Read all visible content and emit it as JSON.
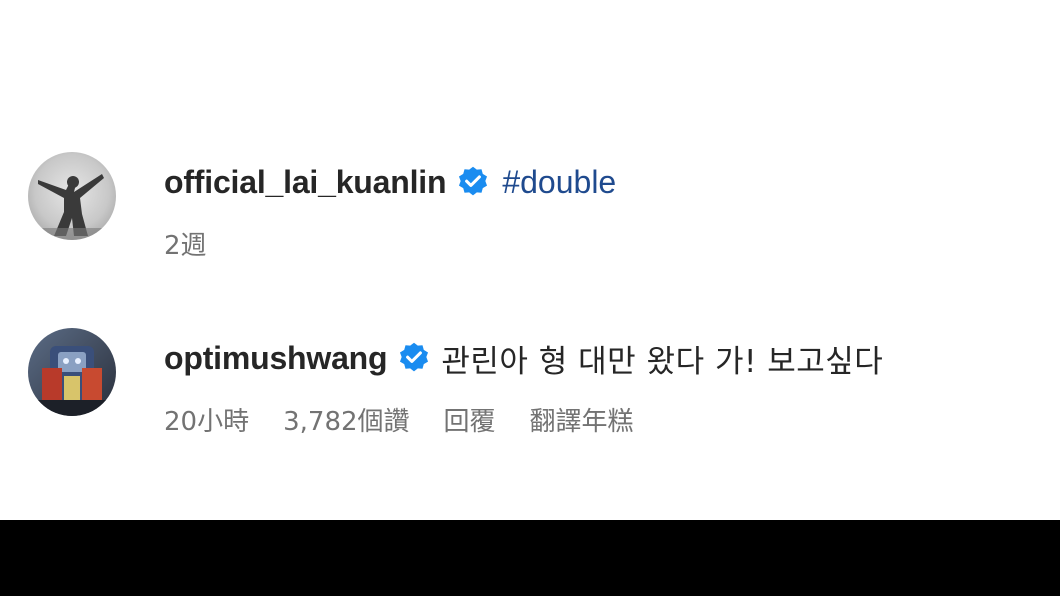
{
  "comments": [
    {
      "username": "official_lai_kuanlin",
      "verified": true,
      "hashtag": "#double",
      "text": "",
      "time": "2週",
      "avatar": "silhouette-avatar"
    },
    {
      "username": "optimushwang",
      "verified": true,
      "hashtag": "",
      "text": "관린아 형 대만 왔다 가! 보고싶다",
      "time": "20小時",
      "likes": "3,782個讚",
      "reply_label": "回覆",
      "translate_label": "翻譯年糕",
      "avatar": "robot-avatar"
    }
  ],
  "colors": {
    "username": "#262626",
    "hashtag": "#1f4a8e",
    "meta": "#737373",
    "verified": "#1a8cf0",
    "bottom_bar": "#000000"
  }
}
